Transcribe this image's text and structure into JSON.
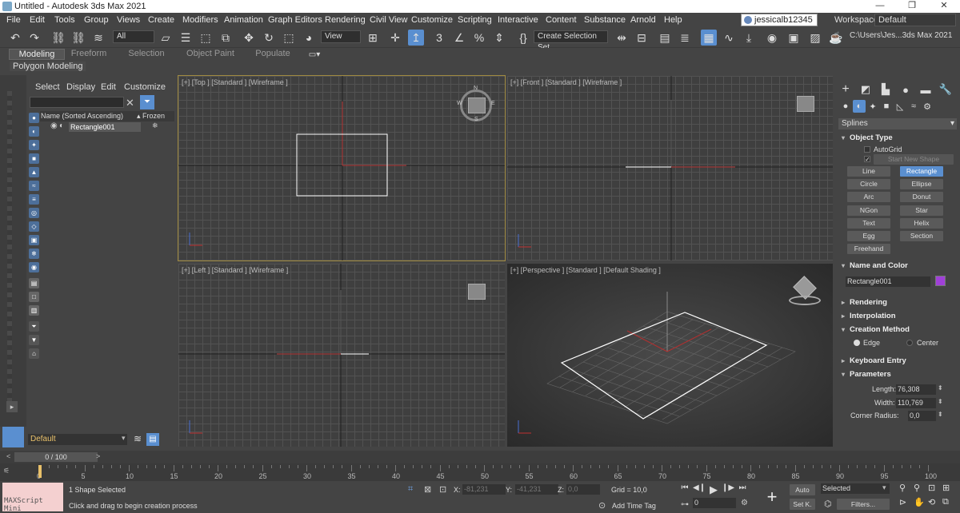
{
  "window": {
    "title": "Untitled - Autodesk 3ds Max 2021",
    "minimize": "—",
    "restore": "❐",
    "close": "✕"
  },
  "menu": [
    "File",
    "Edit",
    "Tools",
    "Group",
    "Views",
    "Create",
    "Modifiers",
    "Animation",
    "Graph Editors",
    "Rendering",
    "Civil View",
    "Customize",
    "Scripting",
    "Interactive",
    "Content",
    "Substance",
    "Arnold",
    "Help"
  ],
  "user": {
    "name": "jessicalb12345"
  },
  "workspaces": {
    "label": "Workspaces:",
    "value": "Default"
  },
  "toolbar": {
    "filter_value": "All",
    "ref_coord_value": "View",
    "selection_set_value": "Create Selection Set",
    "project_path": "C:\\Users\\Jes...3ds Max 2021"
  },
  "ribbon": {
    "tabs": [
      "Modeling",
      "Freeform",
      "Selection",
      "Object Paint",
      "Populate"
    ],
    "active_tab": "Modeling",
    "subtab": "Polygon Modeling"
  },
  "scene_explorer": {
    "menu": [
      "Select",
      "Display",
      "Edit",
      "Customize"
    ],
    "col_name": "Name (Sorted Ascending)",
    "col_frozen": "▴ Frozen",
    "rows": [
      {
        "name": "Rectangle001"
      }
    ]
  },
  "layer": {
    "value": "Default"
  },
  "viewports": {
    "top": "[+] [Top ] [Standard ] [Wireframe ]",
    "front": "[+] [Front ] [Standard ] [Wireframe ]",
    "left": "[+] [Left ] [Standard ] [Wireframe ]",
    "perspective": "[+] [Perspective ] [Standard ] [Default Shading ]",
    "compass": {
      "n": "N",
      "s": "S",
      "e": "E",
      "w": "W"
    }
  },
  "command_panel": {
    "category": "Splines",
    "object_type": {
      "title": "Object Type",
      "autogrid": "AutoGrid",
      "start_new_shape": "Start New Shape",
      "buttons": [
        "Line",
        "Rectangle",
        "Circle",
        "Ellipse",
        "Arc",
        "Donut",
        "NGon",
        "Star",
        "Text",
        "Helix",
        "Egg",
        "Section",
        "Freehand"
      ],
      "active": "Rectangle"
    },
    "name_and_color": {
      "title": "Name and Color",
      "name": "Rectangle001",
      "color": "#a040d8"
    },
    "rendering": "Rendering",
    "interpolation": "Interpolation",
    "creation_method": {
      "title": "Creation Method",
      "edge": "Edge",
      "center": "Center",
      "selected": "Edge"
    },
    "keyboard_entry": "Keyboard Entry",
    "parameters": {
      "title": "Parameters",
      "length_label": "Length:",
      "length": "76,308",
      "width_label": "Width:",
      "width": "110,769",
      "corner_label": "Corner Radius:",
      "corner": "0,0"
    }
  },
  "timeline": {
    "frame_display": "0 / 100",
    "ticks": [
      0,
      5,
      10,
      15,
      20,
      25,
      30,
      35,
      40,
      45,
      50,
      55,
      60,
      65,
      70,
      75,
      80,
      85,
      90,
      95,
      100
    ]
  },
  "status": {
    "maxscript": "MAXScript Mini",
    "selection": "1 Shape Selected",
    "prompt": "Click and drag to begin creation process",
    "x_label": "X:",
    "x": "-81,231",
    "y_label": "Y:",
    "y": "-41,231",
    "z_label": "Z:",
    "z": "0,0",
    "grid": "Grid = 10,0",
    "add_time_tag": "Add Time Tag",
    "frame": "0",
    "auto": "Auto",
    "selected": "Selected",
    "setk": "Set K.",
    "filters": "Filters..."
  }
}
